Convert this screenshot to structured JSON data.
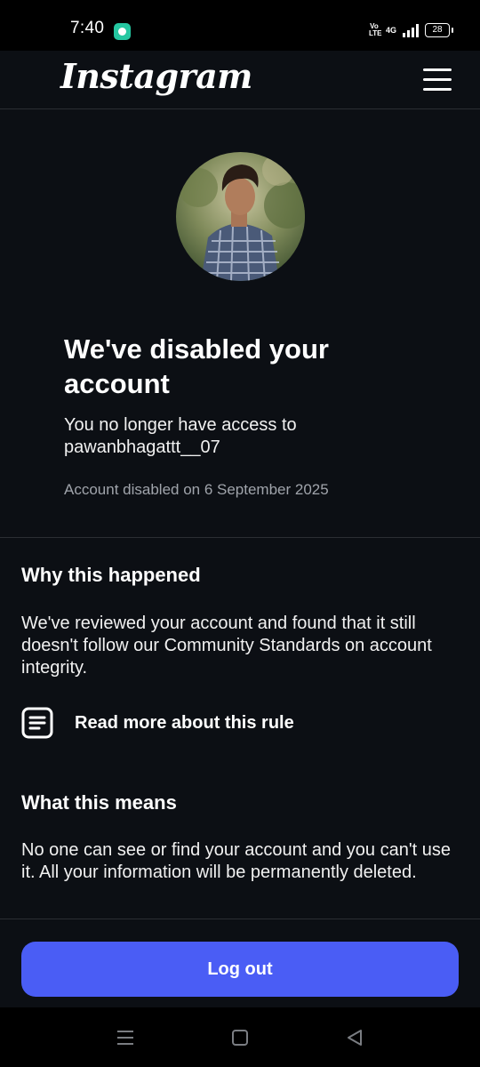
{
  "status_bar": {
    "time": "7:40",
    "network_type": "4G",
    "volte_line1": "Vo",
    "volte_line2": "LTE",
    "battery_level": "28",
    "app_icon": "chat-bubble-icon",
    "app_icon_color": "#25c7a1"
  },
  "header": {
    "logo_text": "Instagram",
    "menu_icon": "hamburger-menu-icon"
  },
  "profile": {
    "avatar": "profile-photo"
  },
  "notice": {
    "title": "We've disabled your account",
    "subtitle": "You no longer have access to pawanbhagattt__07",
    "disabled_date": "Account disabled on 6 September 2025"
  },
  "why": {
    "heading": "Why this happened",
    "text": "We've reviewed your account and found that it still doesn't follow our Community Standards on account integrity.",
    "link_icon": "document-icon",
    "link_label": "Read more about this rule"
  },
  "means": {
    "heading": "What this means",
    "text": "No one can see or find your account and you can't use it. All your information will be permanently deleted."
  },
  "actions": {
    "logout_label": "Log out"
  },
  "colors": {
    "background": "#0c0f14",
    "accent": "#4a5df5",
    "muted_text": "#a0a4ab",
    "divider": "#2b2e33"
  },
  "nav_bar": {
    "icons": [
      "recents-icon",
      "home-icon",
      "back-icon"
    ]
  }
}
